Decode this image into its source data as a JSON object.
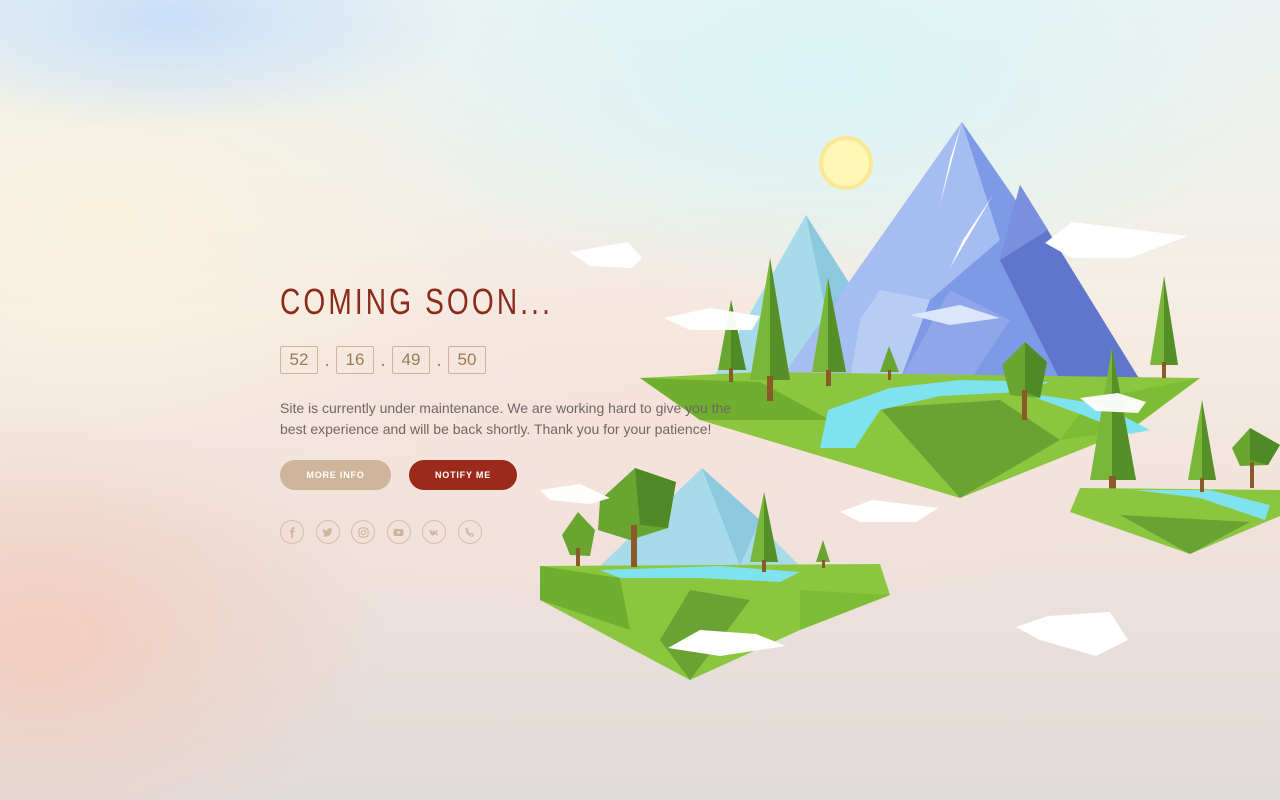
{
  "page": {
    "title": "COMING SOON...",
    "countdown": [
      "52",
      "16",
      "49",
      "50"
    ],
    "separator": ".",
    "description": "Site is currently under maintenance. We are working hard to give you the best experience and will be back shortly. Thank you for your patience!",
    "buttons": {
      "more_info": "MORE INFO",
      "notify_me": "NOTIFY ME"
    },
    "social_icons": [
      "facebook-icon",
      "twitter-icon",
      "instagram-icon",
      "youtube-icon",
      "vk-icon",
      "phone-icon"
    ]
  },
  "colors": {
    "title": "#8c2a1c",
    "countdown": "#9a7b58",
    "more_info_button": "#cfb49c",
    "notify_button": "#9b2a1b",
    "social_icon": "#cfb49c",
    "text": "#6f6766"
  }
}
